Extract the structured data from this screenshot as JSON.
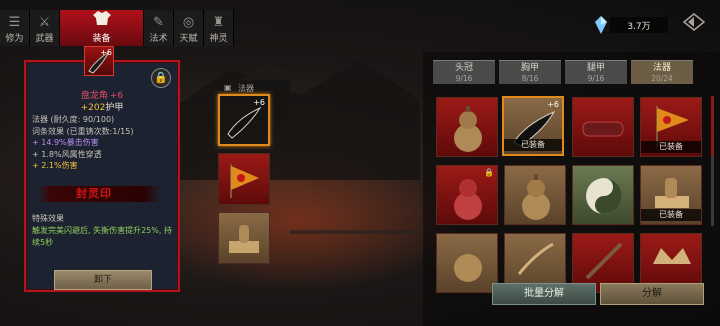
{
  "nav": {
    "tabs": [
      {
        "label": "修为",
        "icon": "figure-icon"
      },
      {
        "label": "武器",
        "icon": "sword-icon"
      },
      {
        "label": "装备",
        "icon": "robe-icon",
        "active": true
      },
      {
        "label": "法术",
        "icon": "scroll-icon"
      },
      {
        "label": "天赋",
        "icon": "taiji-icon"
      },
      {
        "label": "神灵",
        "icon": "statue-icon"
      }
    ]
  },
  "currency": {
    "amount": "3.7万",
    "icon": "crystal-icon"
  },
  "detail": {
    "name": "盘龙角",
    "enhance": "+6",
    "armor_value": "+202",
    "armor_label": "护甲",
    "type_line": "法器 (耐久度: 90/100)",
    "set_line": "词条效果 (已重铸次数:1/15)",
    "affixes": [
      {
        "text": "+ 14.9%暴击伤害",
        "color": "purple"
      },
      {
        "text": "+ 1.8%风属性穿透",
        "color": "gray"
      },
      {
        "text": "+ 2.1%伤害",
        "color": "gold"
      }
    ],
    "seal_text": "封灵印",
    "special_title": "特殊效果",
    "special_desc": "触发完美闪避后, 失衡伤害提升25%, 持续5秒",
    "unequip_label": "卸下"
  },
  "mid": {
    "header": "法器",
    "slots": [
      {
        "item": "horn",
        "plus": "+6",
        "selected": true
      },
      {
        "item": "banner"
      },
      {
        "item": "seal"
      }
    ]
  },
  "tabs": [
    {
      "label": "头冠",
      "count": "9/16"
    },
    {
      "label": "胸甲",
      "count": "8/16"
    },
    {
      "label": "腿甲",
      "count": "9/16"
    },
    {
      "label": "法器",
      "count": "20/24",
      "active": true
    }
  ],
  "inventory": [
    {
      "item": "gourd",
      "bg": "red"
    },
    {
      "item": "horn",
      "bg": "brown",
      "plus": "+6",
      "equipped": "已装备",
      "selected": true
    },
    {
      "item": "gauntlet",
      "bg": "red"
    },
    {
      "item": "banner",
      "bg": "red",
      "equipped": "已装备"
    },
    {
      "item": "red-gourd",
      "bg": "red",
      "lock": true
    },
    {
      "item": "gourd",
      "bg": "brown"
    },
    {
      "item": "taiji",
      "bg": "green"
    },
    {
      "item": "seal",
      "bg": "brown",
      "equipped": "已装备"
    },
    {
      "item": "gourd",
      "bg": "brown"
    },
    {
      "item": "feather",
      "bg": "brown"
    },
    {
      "item": "staff",
      "bg": "red"
    },
    {
      "item": "crown",
      "bg": "red"
    }
  ],
  "actions": {
    "batch_label": "批量分解",
    "decompose_label": "分解"
  },
  "colors": {
    "accent_red": "#b2141c",
    "select_orange": "#e08a1c",
    "gold": "#f2c03a",
    "green_text": "#8fd05a"
  }
}
